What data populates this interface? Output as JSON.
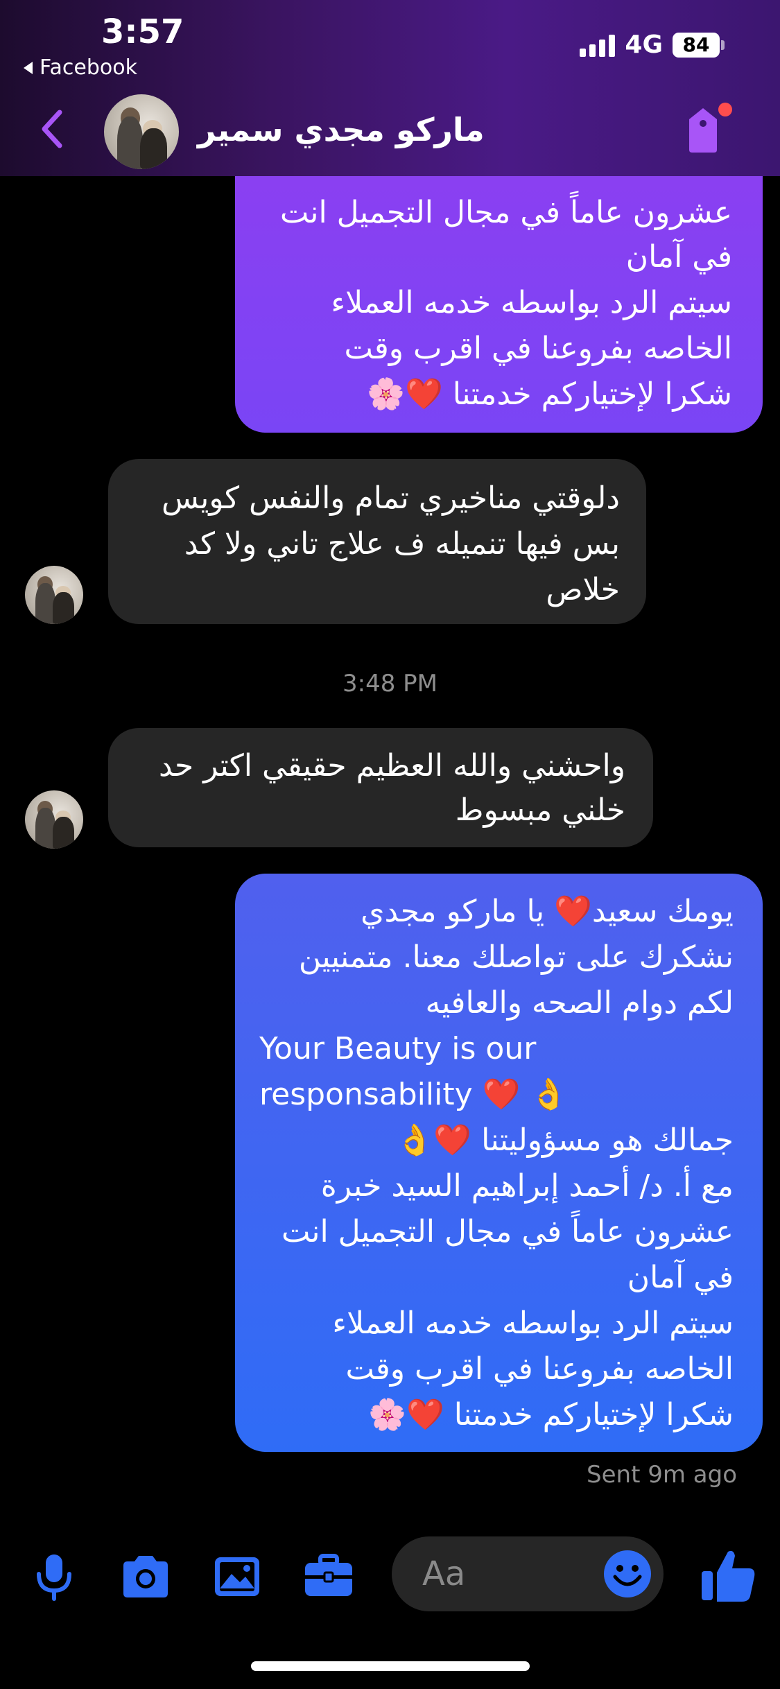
{
  "status_bar": {
    "time": "3:57",
    "back_app": "Facebook",
    "network": "4G",
    "battery": "84"
  },
  "header": {
    "contact_name": "ماركو مجدي سمير"
  },
  "messages": [
    {
      "direction": "outgoing",
      "lines": [
        "عشرون عاماً في مجال التجميل انت",
        "في آمان",
        "سيتم الرد بواسطه خدمه العملاء",
        "الخاصه بفروعنا في اقرب وقت",
        "شكرا لإختياركم خدمتنا ❤️🌸"
      ]
    },
    {
      "direction": "incoming",
      "lines": [
        "دلوقتي مناخيري تمام والنفس كويس",
        "بس فيها تنميله ف علاج تاني ولا كد",
        "خلاص"
      ]
    },
    {
      "direction": "incoming",
      "lines": [
        "واحشني والله العظيم حقيقي اكتر حد",
        "خلني مبسوط"
      ]
    },
    {
      "direction": "outgoing",
      "lines": [
        "يومك سعيد❤️ يا ماركو مجدي",
        "نشكرك على تواصلك معنا. متمنيين",
        "لكم دوام الصحه والعافيه",
        "Your Beauty is our",
        "responsability ❤️ 👌",
        "جمالك هو مسؤوليتنا ❤️👌",
        "مع أ. د/ أحمد إبراهيم السيد خبرة",
        "عشرون عاماً في مجال التجميل انت",
        "في آمان",
        "سيتم الرد بواسطه خدمه العملاء",
        "الخاصه بفروعنا في اقرب وقت",
        "شكرا لإختياركم خدمتنا ❤️🌸"
      ]
    }
  ],
  "timestamp": "3:48 PM",
  "sent_status": "Sent 9m ago",
  "composer": {
    "placeholder": "Aa",
    "icons": [
      "microphone-icon",
      "camera-icon",
      "image-icon",
      "briefcase-icon",
      "emoji-icon",
      "thumbs-up-icon"
    ]
  },
  "colors": {
    "accent": "#2f6cf6",
    "outgoing_top": "#8f3ef0",
    "incoming_bubble": "#262626",
    "header_purple": "#4a1a86",
    "tag_icon": "#a855f7"
  }
}
